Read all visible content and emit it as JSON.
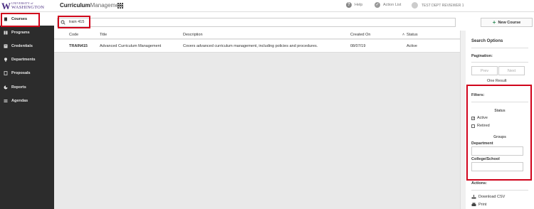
{
  "header": {
    "logo_letter": "W",
    "logo_line1": "UNIVERSITY of",
    "logo_line2": "WASHINGTON",
    "app_bold": "Curriculum",
    "app_light": "Management",
    "help": "Help",
    "action_list": "Action List",
    "user": "TEST DEPT REVIEWER 1"
  },
  "sidebar": {
    "items": [
      {
        "label": "Courses",
        "icon": "document-icon"
      },
      {
        "label": "Programs",
        "icon": "book-icon"
      },
      {
        "label": "Credentials",
        "icon": "credential-icon"
      },
      {
        "label": "Departments",
        "icon": "lightbulb-icon"
      },
      {
        "label": "Proposals",
        "icon": "proposal-icon"
      },
      {
        "label": "Reports",
        "icon": "chart-icon"
      },
      {
        "label": "Agendas",
        "icon": "agenda-icon"
      }
    ]
  },
  "search": {
    "value": "train 415"
  },
  "new_course_label": "New Course",
  "table": {
    "headers": [
      "Code",
      "Title",
      "Description",
      "Created On",
      "Status"
    ],
    "rows": [
      {
        "code": "TRAIN415",
        "title": "Advanced Curriculum Management",
        "description": "Covers advanced curriculum management, including policies and procedures.",
        "created": "08/07/19",
        "status": "Active"
      }
    ]
  },
  "panel": {
    "title": "Search Options",
    "pagination": "Pagination:",
    "prev": "Prev",
    "next": "Next",
    "result": "One Result",
    "filters": "Filters:",
    "status_label": "Status",
    "active": "Active",
    "retired": "Retired",
    "groups_label": "Groups",
    "department": "Department",
    "college": "College/School",
    "actions": "Actions:",
    "download": "Download CSV",
    "print": "Print"
  },
  "colors": {
    "accent_red": "#d0021b",
    "uw_purple": "#4b2e83",
    "sidebar_bg": "#2c2c2c"
  }
}
